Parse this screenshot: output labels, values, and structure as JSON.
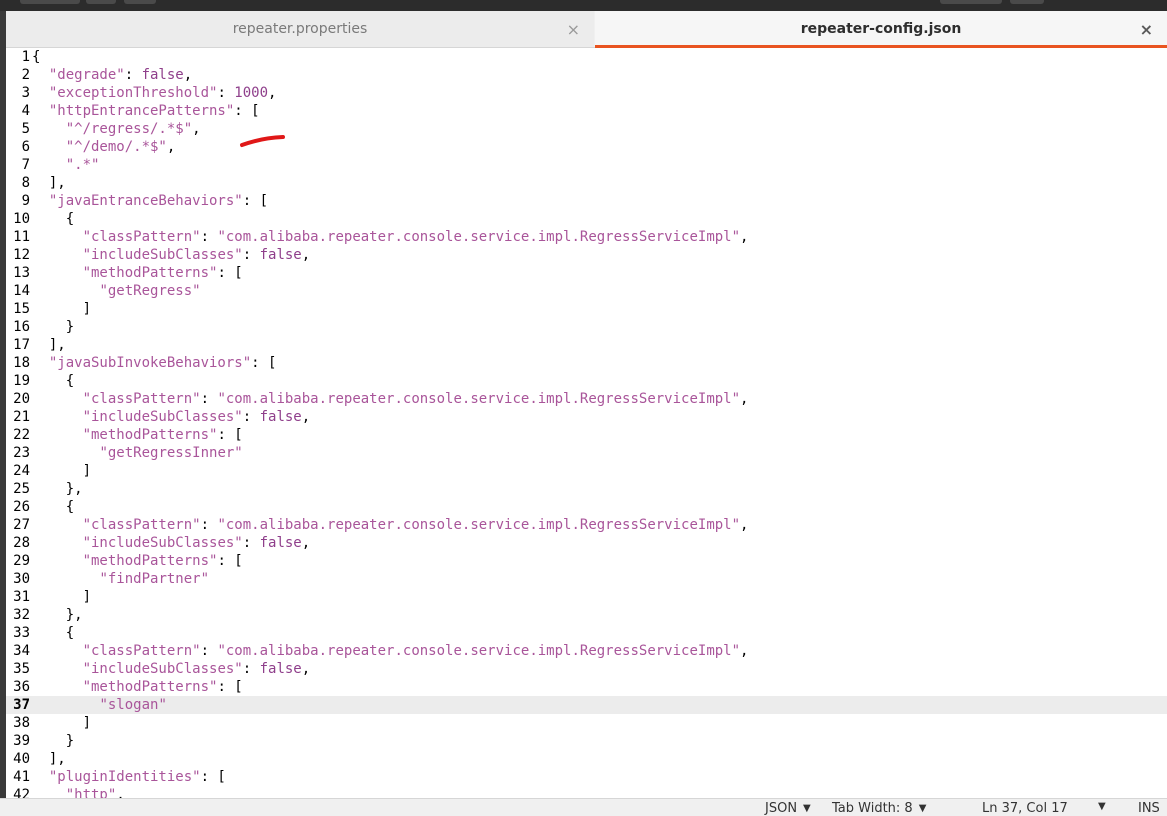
{
  "tabs": [
    {
      "label": "repeater.properties",
      "active": false
    },
    {
      "label": "repeater-config.json",
      "active": true
    }
  ],
  "editor": {
    "current_line": 37,
    "lines": [
      "{",
      "  \"degrade\": false,",
      "  \"exceptionThreshold\": 1000,",
      "  \"httpEntrancePatterns\": [",
      "    \"^/regress/.*$\",",
      "    \"^/demo/.*$\",",
      "    \".*\"",
      "  ],",
      "  \"javaEntranceBehaviors\": [",
      "    {",
      "      \"classPattern\": \"com.alibaba.repeater.console.service.impl.RegressServiceImpl\",",
      "      \"includeSubClasses\": false,",
      "      \"methodPatterns\": [",
      "        \"getRegress\"",
      "      ]",
      "    }",
      "  ],",
      "  \"javaSubInvokeBehaviors\": [",
      "    {",
      "      \"classPattern\": \"com.alibaba.repeater.console.service.impl.RegressServiceImpl\",",
      "      \"includeSubClasses\": false,",
      "      \"methodPatterns\": [",
      "        \"getRegressInner\"",
      "      ]",
      "    },",
      "    {",
      "      \"classPattern\": \"com.alibaba.repeater.console.service.impl.RegressServiceImpl\",",
      "      \"includeSubClasses\": false,",
      "      \"methodPatterns\": [",
      "        \"findPartner\"",
      "      ]",
      "    },",
      "    {",
      "      \"classPattern\": \"com.alibaba.repeater.console.service.impl.RegressServiceImpl\",",
      "      \"includeSubClasses\": false,",
      "      \"methodPatterns\": [",
      "        \"slogan\"",
      "      ]",
      "    }",
      "  ],",
      "  \"pluginIdentities\": [",
      "    \"http\","
    ]
  },
  "statusbar": {
    "language": "JSON",
    "tab_width": "Tab Width: 8",
    "position": "Ln 37, Col 17",
    "mode": "INS"
  },
  "colors": {
    "accent": "#e95420",
    "syntax_string": "#a9559a",
    "annotation": "#e01818"
  },
  "icons": {
    "tab_close": "close-icon",
    "dropdown": "chevron-down-icon"
  }
}
